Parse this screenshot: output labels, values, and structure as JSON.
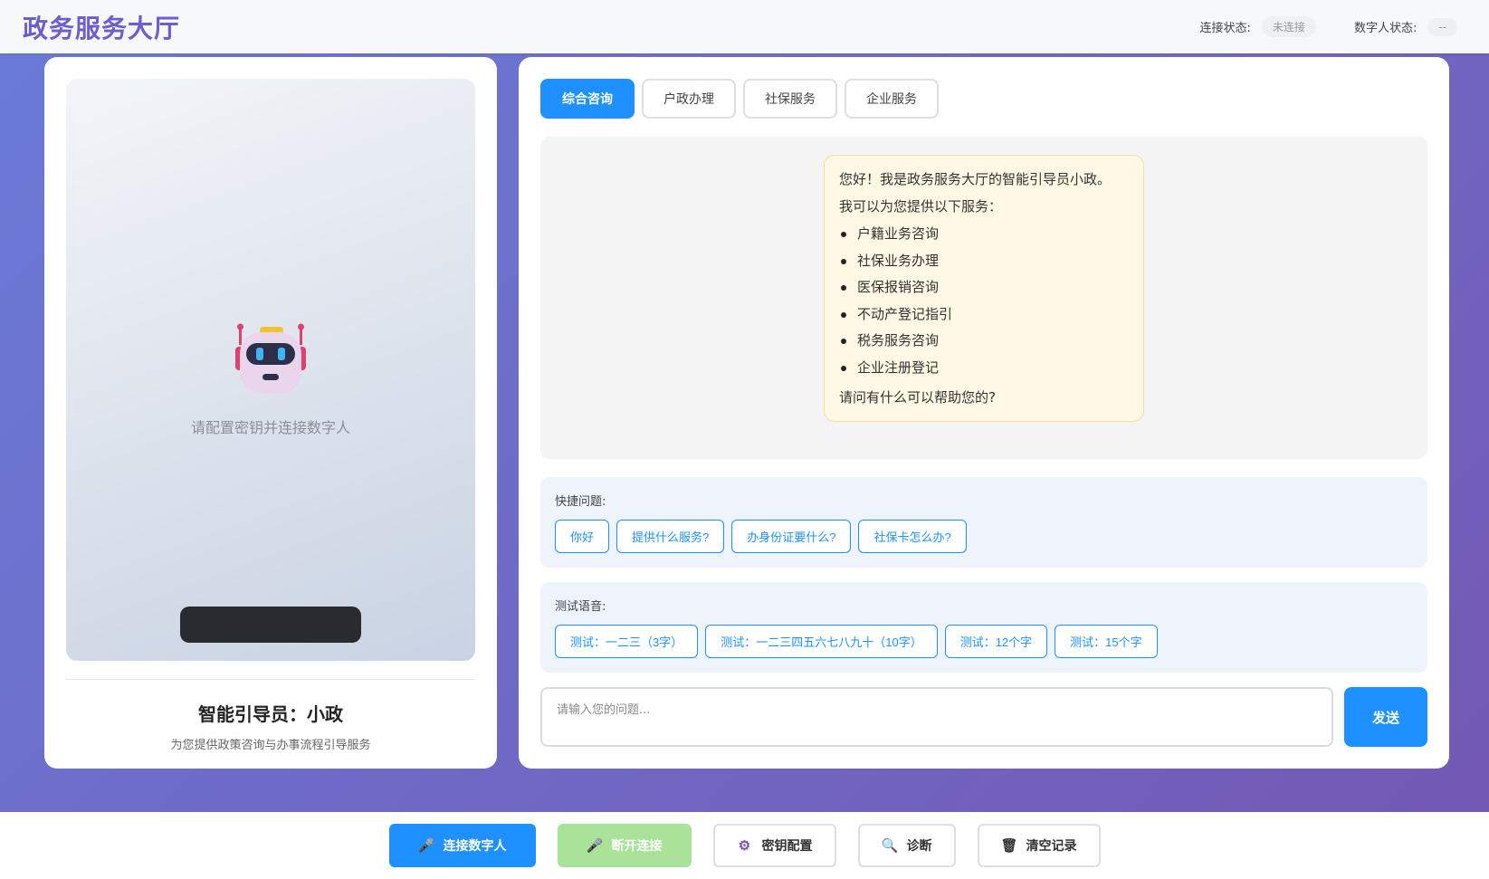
{
  "header": {
    "title": "政务服务大厅",
    "connection_label": "连接状态:",
    "connection_value": "未连接",
    "avatar_label": "数字人状态:",
    "avatar_value": "--"
  },
  "left_panel": {
    "placeholder": "请配置密钥并连接数字人",
    "agent_name": "智能引导员：小政",
    "agent_desc": "为您提供政策咨询与办事流程引导服务"
  },
  "tabs": [
    "综合咨询",
    "户政办理",
    "社保服务",
    "企业服务"
  ],
  "chat": {
    "greeting": "您好！我是政务服务大厅的智能引导员小政。",
    "intro": "我可以为您提供以下服务：",
    "services": [
      "户籍业务咨询",
      "社保业务办理",
      "医保报销咨询",
      "不动产登记指引",
      "税务服务咨询",
      "企业注册登记"
    ],
    "closing": "请问有什么可以帮助您的?"
  },
  "quick_questions": {
    "label": "快捷问题:",
    "items": [
      "你好",
      "提供什么服务?",
      "办身份证要什么?",
      "社保卡怎么办?"
    ]
  },
  "voice_test": {
    "label": "测试语音:",
    "items": [
      "测试：一二三（3字）",
      "测试：一二三四五六七八九十（10字）",
      "测试：12个字",
      "测试：15个字"
    ]
  },
  "input": {
    "placeholder": "请输入您的问题...",
    "send_label": "发送"
  },
  "footer": {
    "connect": "连接数字人",
    "disconnect": "断开连接",
    "key_config": "密钥配置",
    "diagnose": "诊断",
    "clear": "清空记录"
  },
  "colors": {
    "primary": "#1e90ff",
    "title": "#6b5fd0",
    "disabled_green": "#a9e39a",
    "bubble_bg": "#fef8e5"
  },
  "icons": {
    "connect": "microphone-icon",
    "disconnect": "microphone-icon",
    "key_config": "gear-icon",
    "diagnose": "magnifier-icon",
    "clear": "trash-icon"
  }
}
